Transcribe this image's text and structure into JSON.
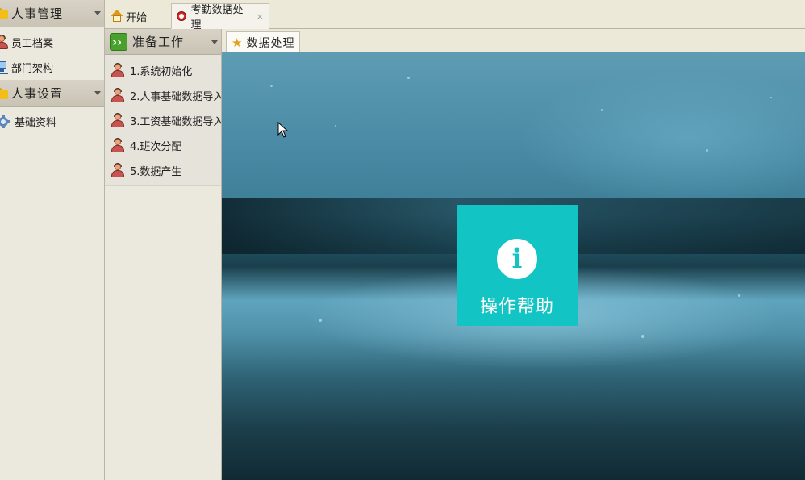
{
  "left_sidebar": {
    "sections": [
      {
        "title": "人事管理",
        "items": [
          {
            "label": "员工档案",
            "icon": "person-icon"
          },
          {
            "label": "部门架构",
            "icon": "network-icon"
          }
        ]
      },
      {
        "title": "人事设置",
        "items": [
          {
            "label": "基础资料",
            "icon": "gear-icon"
          }
        ]
      }
    ]
  },
  "top_tabs": [
    {
      "label": "开始",
      "icon": "home-icon"
    },
    {
      "label": "考勤数据处理",
      "icon": "bug-icon",
      "close": "×"
    }
  ],
  "mid_panel": {
    "title": "准备工作",
    "items": [
      {
        "label": "1.系统初始化"
      },
      {
        "label": "2.人事基础数据导入"
      },
      {
        "label": "3.工资基础数据导入"
      },
      {
        "label": "4.班次分配"
      },
      {
        "label": "5.数据产生"
      }
    ]
  },
  "inner_tab": {
    "label": "数据处理",
    "icon": "star-icon"
  },
  "help_tile": {
    "icon_glyph": "i",
    "label": "操作帮助",
    "color": "#12c4c4"
  }
}
